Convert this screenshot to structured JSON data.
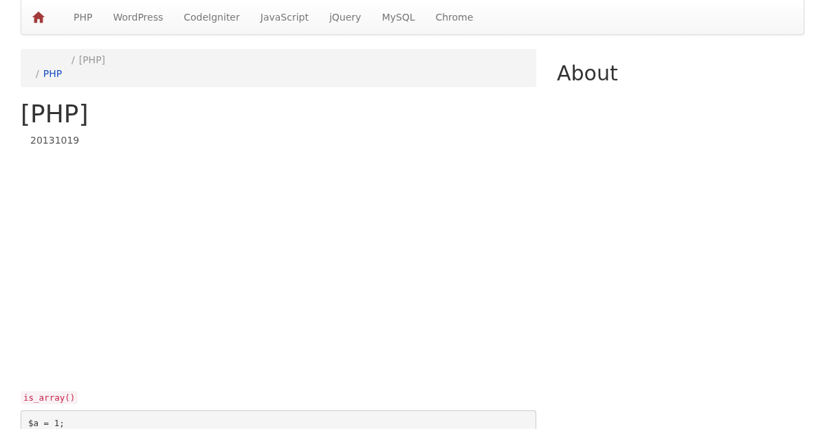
{
  "navbar": {
    "items": [
      {
        "label": "PHP"
      },
      {
        "label": "WordPress"
      },
      {
        "label": "CodeIgniter"
      },
      {
        "label": "JavaScript"
      },
      {
        "label": "jQuery"
      },
      {
        "label": "MySQL"
      },
      {
        "label": "Chrome"
      }
    ]
  },
  "breadcrumb": {
    "separator": "/",
    "items": [
      {
        "label": "[PHP]",
        "kind": "current"
      },
      {
        "label": "PHP",
        "kind": "link"
      }
    ]
  },
  "article": {
    "title": "[PHP]",
    "date": "20131019",
    "inline_code": "is_array()",
    "code_lines": [
      "$a = 1;"
    ]
  },
  "sidebar": {
    "title": "About"
  }
}
